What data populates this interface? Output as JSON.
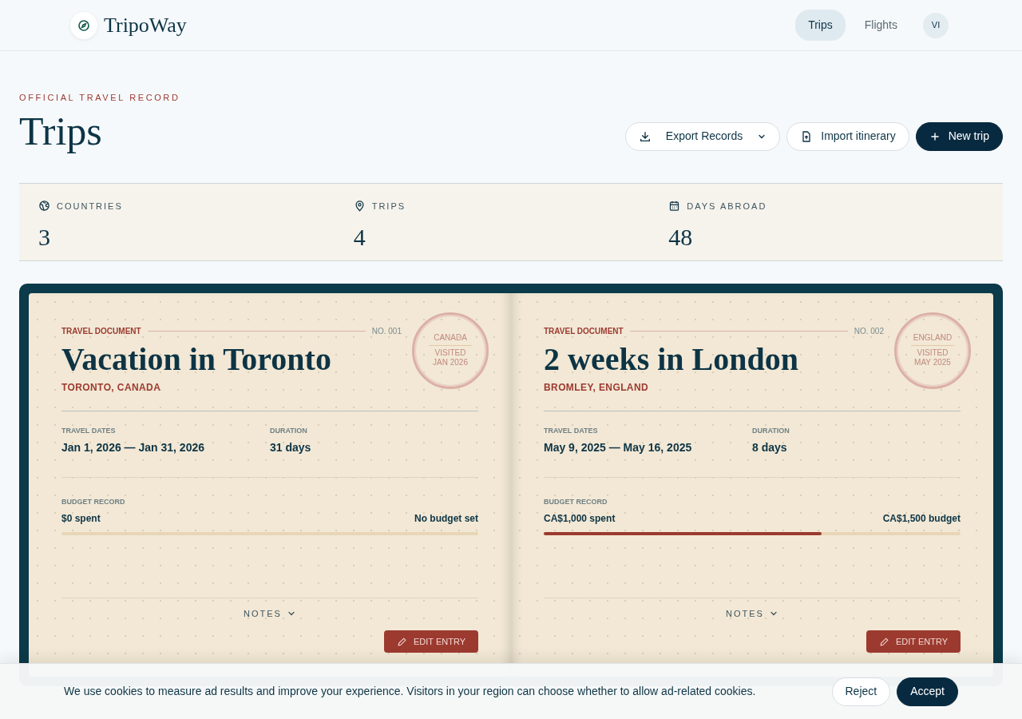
{
  "brand": {
    "name": "TripoWay"
  },
  "nav": [
    {
      "label": "Trips",
      "selected": true
    },
    {
      "label": "Flights",
      "selected": false
    }
  ],
  "avatar": {
    "initials": "VI"
  },
  "header": {
    "eyebrow": "OFFICIAL TRAVEL RECORD",
    "title": "Trips"
  },
  "actions": [
    {
      "kind": "dropdown",
      "label": "Export Records"
    },
    {
      "kind": "outline",
      "label": "Import itinerary"
    },
    {
      "kind": "primary",
      "label": "New trip"
    }
  ],
  "stats": [
    {
      "kind": "globe",
      "label": "COUNTRIES",
      "value": "3"
    },
    {
      "kind": "pin",
      "label": "TRIPS",
      "value": "4"
    },
    {
      "kind": "calendar",
      "label": "DAYS ABROAD",
      "value": "48"
    }
  ],
  "trips": [
    {
      "doc_label": "TRAVEL DOCUMENT",
      "number": "NO. 001",
      "title": "Vacation in Toronto",
      "location": "TORONTO, CANADA",
      "stamp": {
        "country": "CANADA",
        "label": "VISITED",
        "date": "JAN 2026"
      },
      "dates_label": "TRAVEL DATES",
      "dates": "Jan 1, 2026 — Jan 31, 2026",
      "duration_label": "DURATION",
      "duration": "31 days",
      "budget_label": "BUDGET RECORD",
      "spent": "$0 spent",
      "budget": "No budget set",
      "level": 0,
      "notes_label": "NOTES",
      "edit_label": "EDIT ENTRY"
    },
    {
      "doc_label": "TRAVEL DOCUMENT",
      "number": "NO. 002",
      "title": "2 weeks in London",
      "location": "BROMLEY, ENGLAND",
      "stamp": {
        "country": "ENGLAND",
        "label": "VISITED",
        "date": "MAY 2025"
      },
      "dates_label": "TRAVEL DATES",
      "dates": "May 9, 2025 — May 16, 2025",
      "duration_label": "DURATION",
      "duration": "8 days",
      "budget_label": "BUDGET RECORD",
      "spent": "CA$1,000 spent",
      "budget": "CA$1,500 budget",
      "level": 0.667,
      "notes_label": "NOTES",
      "edit_label": "EDIT ENTRY"
    }
  ],
  "cookie": {
    "text": "We use cookies to measure ad results and improve your experience. Visitors in your region can choose whether to allow ad-related cookies.",
    "buttons": [
      {
        "kind": "outline",
        "label": "Reject"
      },
      {
        "kind": "primary",
        "label": "Accept"
      }
    ]
  }
}
